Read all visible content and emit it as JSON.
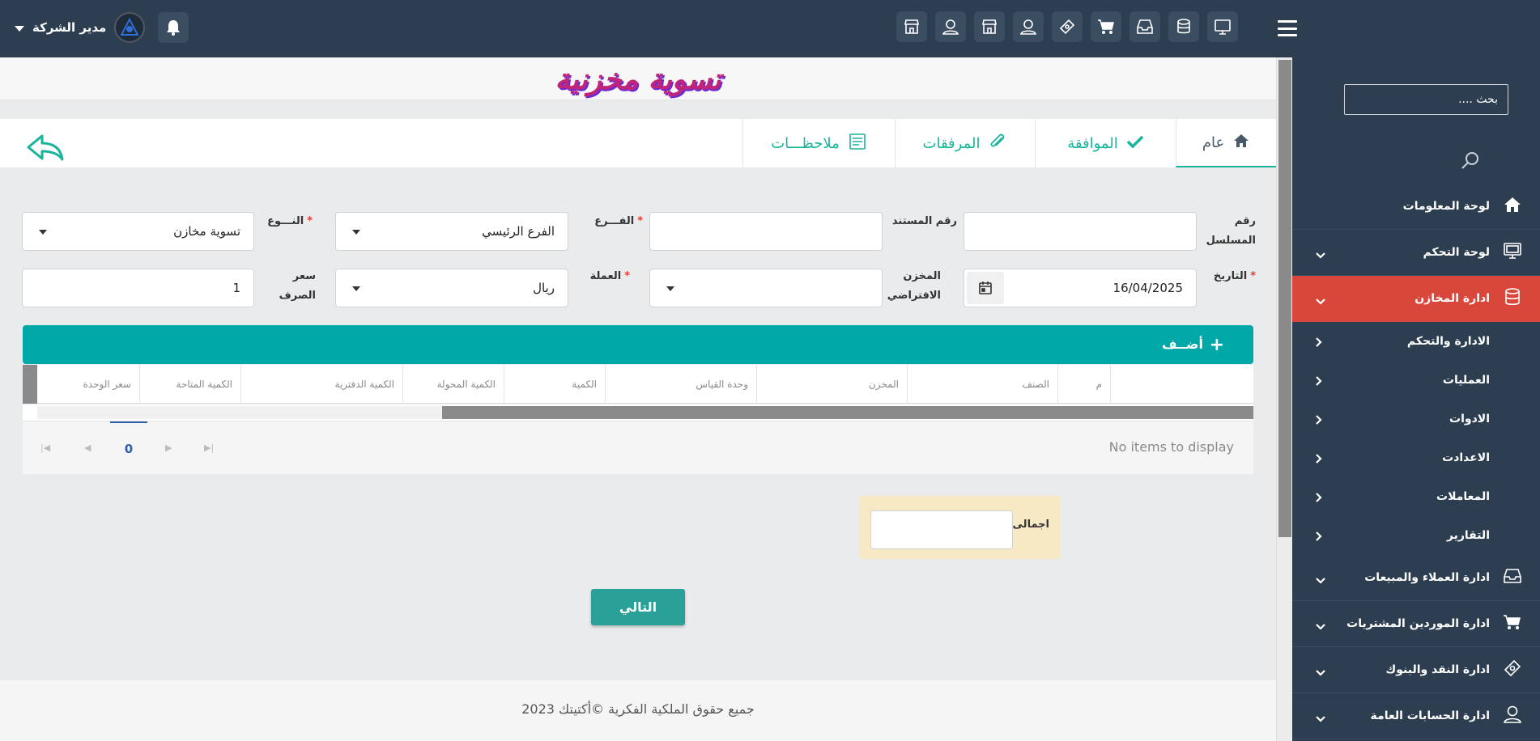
{
  "header": {
    "user_name": "مدير الشركة",
    "top_icons": [
      "monitor-icon",
      "database-icon",
      "inbox-icon",
      "cart-icon",
      "money-icon",
      "user-icon",
      "store-icon",
      "user-icon",
      "store-icon"
    ]
  },
  "sidebar": {
    "search_placeholder": "بحث ....",
    "items": [
      {
        "label": "لوحة المعلومات",
        "icon": "home-icon"
      },
      {
        "label": "لوحة التحكم",
        "icon": "monitor-icon"
      },
      {
        "label": "ادارة المخازن",
        "icon": "database-icon",
        "active": true
      },
      {
        "label": "ادارة العملاء والمبيعات",
        "icon": "inbox-icon"
      },
      {
        "label": "ادارة الموردين المشتريات",
        "icon": "cart-icon"
      },
      {
        "label": "ادارة النقد والبنوك",
        "icon": "money-icon"
      },
      {
        "label": "ادارة الحسابات العامة",
        "icon": "user-icon"
      }
    ],
    "subitems": [
      {
        "label": "الادارة والتحكم"
      },
      {
        "label": "العمليات"
      },
      {
        "label": "الادوات"
      },
      {
        "label": "الاعدادت"
      },
      {
        "label": "المعاملات"
      },
      {
        "label": "التقارير"
      }
    ]
  },
  "page": {
    "title": "تسوية مخزنية"
  },
  "tabs": [
    {
      "label": "عام",
      "icon": "home-icon"
    },
    {
      "label": "الموافقة",
      "icon": "check-icon"
    },
    {
      "label": "المرفقات",
      "icon": "paperclip-icon"
    },
    {
      "label": "ملاحظـــات",
      "icon": "notes-icon"
    }
  ],
  "form": {
    "serial_label_1": "رقم",
    "serial_label_2": "المسلسل",
    "serial_value": "",
    "doc_number_label": "رقم المستند",
    "doc_number_value": "",
    "branch_label": "الفـــرع",
    "branch_value": "الفرع الرئيسي",
    "type_label": "النـــوع",
    "type_value": "تسوية مخازن",
    "date_label": "التاريخ",
    "date_value": "16/04/2025",
    "warehouse_label_1": "المخزن",
    "warehouse_label_2": "الافتراضي",
    "warehouse_value": "",
    "currency_label": "العملة",
    "currency_value": "ريال",
    "rate_label": "سعر الصرف",
    "rate_value": "1"
  },
  "grid": {
    "add_label": "أضــف",
    "columns": [
      "م",
      "الصنف",
      "المخزن",
      "وحدة القياس",
      "الكمية",
      "الكمية المحولة",
      "الكمية الدفترية",
      "الكمية المتاحة",
      "سعر الوحدة"
    ],
    "page_number": "0",
    "empty_text": "No items to display"
  },
  "total": {
    "label": "اجمالى",
    "value": ""
  },
  "next_label": "التالي",
  "footer": {
    "text": "جميع حقوق الملكية الفكرية ©أكتيتك 2023"
  },
  "colors": {
    "header_bg": "#2c3e50",
    "active_menu": "#d9473a",
    "teal": "#00a8a8",
    "next_button": "#2aa198"
  }
}
